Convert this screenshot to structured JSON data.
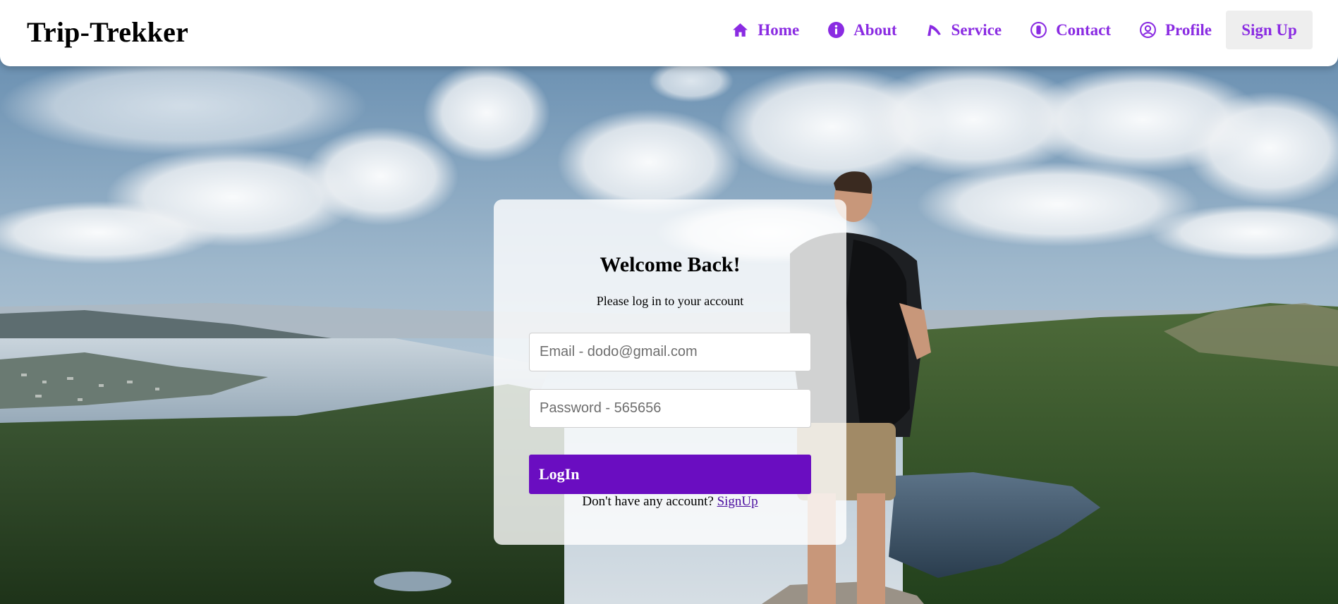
{
  "brand": {
    "name": "Trip-Trekker"
  },
  "nav": {
    "items": [
      {
        "label": "Home",
        "icon": "home-icon"
      },
      {
        "label": "About",
        "icon": "info-icon"
      },
      {
        "label": "Service",
        "icon": "service-icon"
      },
      {
        "label": "Contact",
        "icon": "contact-icon"
      },
      {
        "label": "Profile",
        "icon": "profile-icon"
      }
    ],
    "signup_label": "Sign Up"
  },
  "login": {
    "title": "Welcome Back!",
    "subtitle": "Please log in to your account",
    "email_placeholder": "Email - dodo@gmail.com",
    "password_placeholder": "Password - 565656",
    "button_label": "LogIn",
    "no_account_text": "Don't have any account?",
    "signup_link": "SignUp"
  },
  "colors": {
    "accent": "#8a2be2",
    "button": "#6a0dc1",
    "link": "#4b0fa0"
  }
}
